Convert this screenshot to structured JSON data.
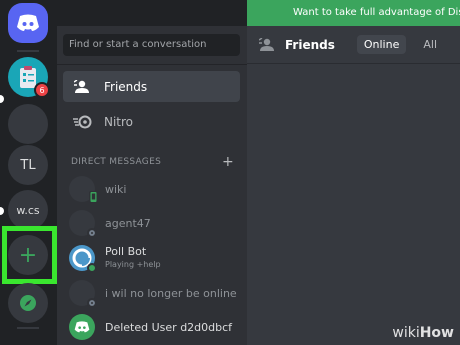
{
  "colors": {
    "accent": "#5865f2",
    "online": "#3ba55d",
    "highlight": "#3ae62f",
    "notification": "#ed4245"
  },
  "servers": {
    "home_icon": "discord-logo-icon",
    "clipboard_badge": "6",
    "tl_label": "TL",
    "wcs_label": "w.cs",
    "add_icon": "+",
    "explore_icon": "compass-icon"
  },
  "banner": {
    "text": "Want to take full advantage of Disco"
  },
  "sidebar": {
    "search_placeholder": "Find or start a conversation",
    "friends_label": "Friends",
    "nitro_label": "Nitro",
    "dm_header": "DIRECT MESSAGES",
    "dm_add": "+",
    "dms": [
      {
        "name": "wiki",
        "status": ""
      },
      {
        "name": "agent47",
        "status": ""
      },
      {
        "name": "Poll Bot",
        "status": "Playing +help"
      },
      {
        "name": "i wil no longer be online",
        "status": ""
      },
      {
        "name": "Deleted User d2d0dbcf",
        "status": ""
      }
    ]
  },
  "header": {
    "title": "Friends",
    "tabs": [
      "Online",
      "All"
    ]
  },
  "watermark": {
    "prefix": "wiki",
    "suffix": "How"
  }
}
